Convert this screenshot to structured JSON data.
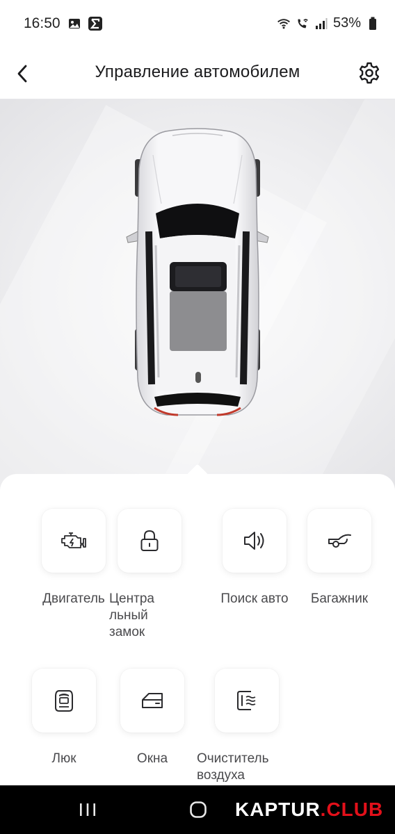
{
  "status": {
    "time": "16:50",
    "battery": "53%"
  },
  "header": {
    "title": "Управление автомобилем"
  },
  "controls": [
    {
      "label": "Двигатель",
      "icon": "engine-icon"
    },
    {
      "label": "Центра\nльный\nзамок",
      "icon": "lock-icon"
    },
    {
      "label": "Поиск авто",
      "icon": "speaker-icon"
    },
    {
      "label": "Багажник",
      "icon": "trunk-icon"
    },
    {
      "label": "Люк",
      "icon": "sunroof-icon"
    },
    {
      "label": "Окна",
      "icon": "window-icon"
    },
    {
      "label": "Очиститель\nвоздуха",
      "icon": "air-purifier-icon"
    }
  ],
  "watermark": {
    "brand": "KAPTUR",
    "dot": ".",
    "club": "CLUB"
  }
}
